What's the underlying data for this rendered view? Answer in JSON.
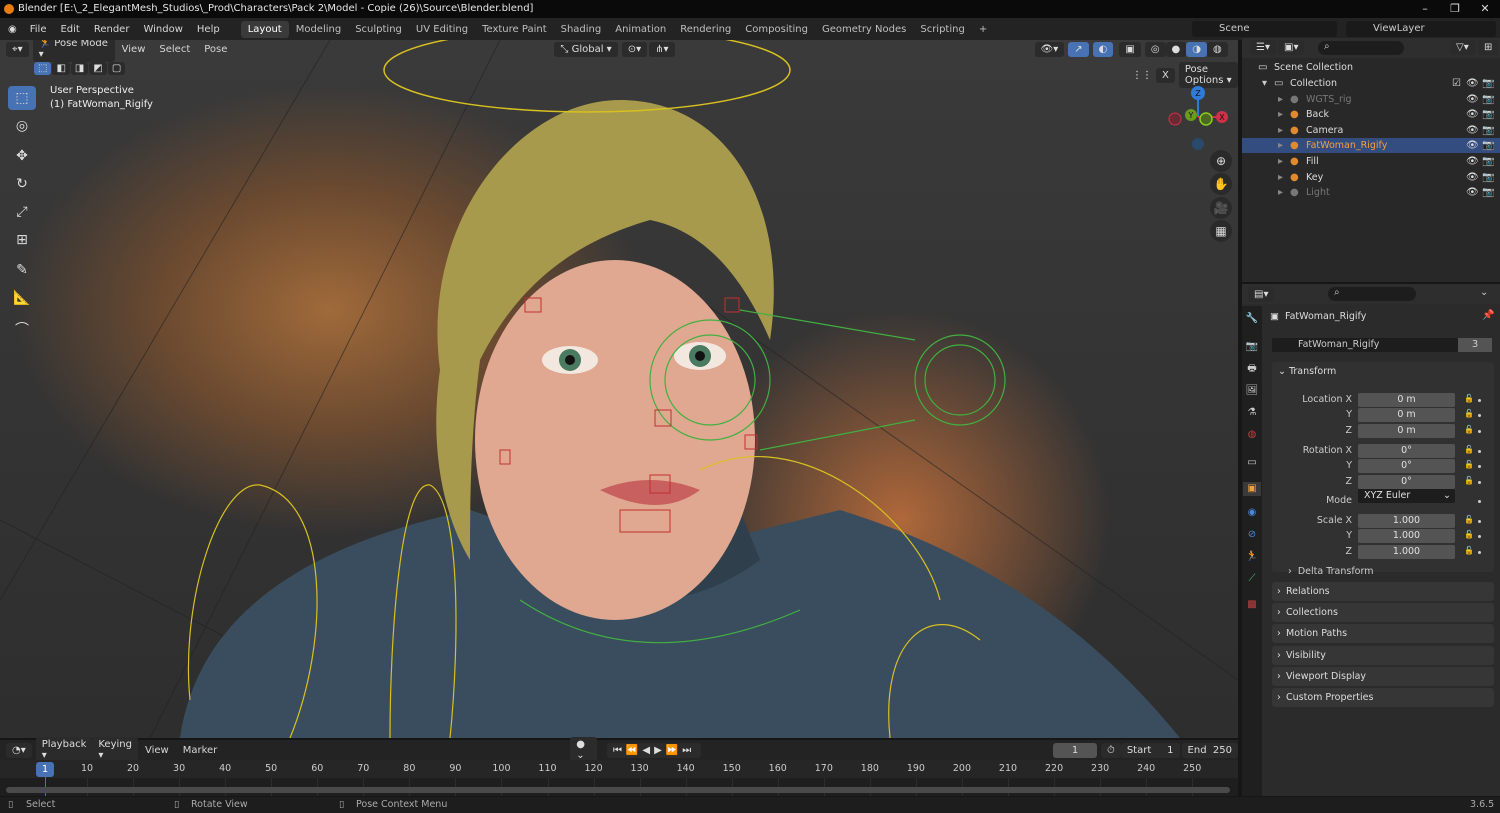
{
  "window": {
    "title": "Blender [E:\\_2_ElegantMesh_Studios\\_Prod\\Characters\\Pack 2\\Model - Copie (26)\\Source\\Blender.blend]"
  },
  "menu": [
    "File",
    "Edit",
    "Render",
    "Window",
    "Help"
  ],
  "workspaces": [
    "Layout",
    "Modeling",
    "Sculpting",
    "UV Editing",
    "Texture Paint",
    "Shading",
    "Animation",
    "Rendering",
    "Compositing",
    "Geometry Nodes",
    "Scripting",
    "+"
  ],
  "scene": {
    "name": "Scene",
    "view_layer": "ViewLayer"
  },
  "viewport": {
    "mode": "Pose Mode",
    "menus": [
      "View",
      "Select",
      "Pose"
    ],
    "orientation": "Global",
    "pose_options": "Pose Options",
    "overlay_title": "User Perspective",
    "overlay_object": "(1) FatWoman_Rigify",
    "gizmo": {
      "x": "X",
      "y": "Y",
      "z": "Z"
    },
    "mirror": "X"
  },
  "outliner": {
    "root": "Scene Collection",
    "items": [
      {
        "name": "Collection",
        "depth": 0
      },
      {
        "name": "WGTS_rig",
        "depth": 1,
        "dim": true
      },
      {
        "name": "Back",
        "depth": 1
      },
      {
        "name": "Camera",
        "depth": 1
      },
      {
        "name": "FatWoman_Rigify",
        "depth": 1,
        "selected": true
      },
      {
        "name": "Fill",
        "depth": 1
      },
      {
        "name": "Key",
        "depth": 1
      },
      {
        "name": "Light",
        "depth": 1,
        "dim": true
      }
    ]
  },
  "properties": {
    "object_name": "FatWoman_Rigify",
    "data_name": "FatWoman_Rigify",
    "users": "3",
    "transform": {
      "title": "Transform",
      "location": {
        "label": "Location X",
        "x": "0 m",
        "y": "0 m",
        "z": "0 m"
      },
      "rotation": {
        "label": "Rotation X",
        "x": "0°",
        "y": "0°",
        "z": "0°"
      },
      "mode_label": "Mode",
      "mode": "XYZ Euler",
      "scale": {
        "label": "Scale X",
        "x": "1.000",
        "y": "1.000",
        "z": "1.000"
      },
      "axis_y": "Y",
      "axis_z": "Z",
      "delta": "Delta Transform"
    },
    "panels": [
      "Relations",
      "Collections",
      "Motion Paths",
      "Visibility",
      "Viewport Display",
      "Custom Properties"
    ]
  },
  "timeline": {
    "menus": [
      "Playback",
      "Keying",
      "View",
      "Marker"
    ],
    "current_frame": "1",
    "start_label": "Start",
    "start": "1",
    "end_label": "End",
    "end": "250",
    "ticks": [
      "10",
      "20",
      "30",
      "40",
      "50",
      "60",
      "70",
      "80",
      "90",
      "100",
      "110",
      "120",
      "130",
      "140",
      "150",
      "160",
      "170",
      "180",
      "190",
      "200",
      "210",
      "220",
      "230",
      "240",
      "250"
    ]
  },
  "status": {
    "left": "Select",
    "middle": "Rotate View",
    "right": "Pose Context Menu",
    "version": "3.6.5"
  },
  "colors": {
    "accent": "#4772b3",
    "selected_object": "#f0a040",
    "bone_yellow": "#d8c020",
    "bone_green": "#40b040",
    "bone_red": "#c03030"
  }
}
